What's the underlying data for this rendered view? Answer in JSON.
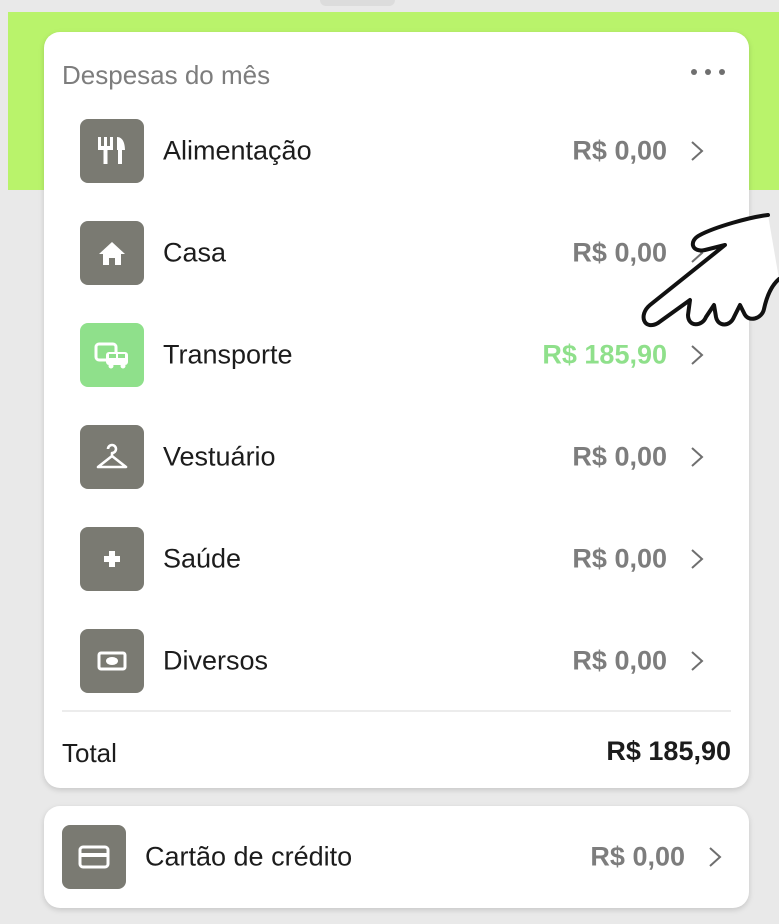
{
  "expenses": {
    "title": "Despesas do mês",
    "items": [
      {
        "label": "Alimentação",
        "amount": "R$ 0,00",
        "icon": "fork-knife-icon"
      },
      {
        "label": "Casa",
        "amount": "R$ 0,00",
        "icon": "house-icon"
      },
      {
        "label": "Transporte",
        "amount": "R$ 185,90",
        "icon": "vehicles-icon"
      },
      {
        "label": "Vestuário",
        "amount": "R$ 0,00",
        "icon": "hanger-icon"
      },
      {
        "label": "Saúde",
        "amount": "R$ 0,00",
        "icon": "plus-icon"
      },
      {
        "label": "Diversos",
        "amount": "R$ 0,00",
        "icon": "banknote-icon"
      }
    ],
    "total_label": "Total",
    "total_value": "R$ 185,90"
  },
  "credit_card": {
    "label": "Cartão de crédito",
    "amount": "R$ 0,00",
    "icon": "credit-card-icon"
  },
  "colors": {
    "accent_green": "#b9f36b",
    "active_green": "#8fe08b",
    "icon_gray": "#7a7a72",
    "amount_gray": "#7d7d7d"
  }
}
